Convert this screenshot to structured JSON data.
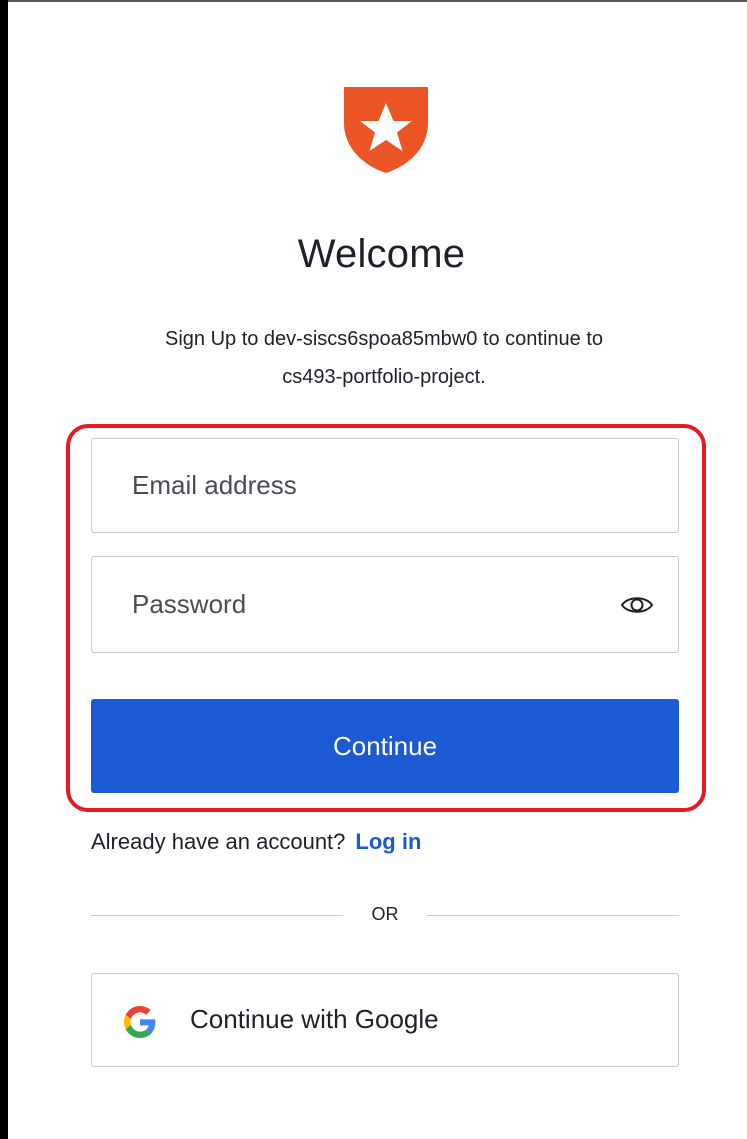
{
  "header": {
    "title": "Welcome",
    "subtitle_line1": "Sign Up to dev-siscs6spoa85mbw0 to continue to",
    "subtitle_line2": "cs493-portfolio-project."
  },
  "form": {
    "email_placeholder": "Email address",
    "email_value": "",
    "password_placeholder": "Password",
    "password_value": "",
    "continue_label": "Continue"
  },
  "login_prompt": {
    "text": "Already have an account?",
    "link_label": "Log in"
  },
  "divider": {
    "label": "OR"
  },
  "social": {
    "google_label": "Continue with Google"
  },
  "icons": {
    "logo": "auth0-shield-star-icon",
    "password_toggle": "eye-icon",
    "google": "google-g-icon"
  },
  "colors": {
    "brand_orange": "#eb5424",
    "primary_button": "#1b5ad3",
    "link": "#1b5ad3",
    "highlight_border": "#e31b23",
    "input_border": "#c9cace",
    "text": "#1e212a"
  }
}
